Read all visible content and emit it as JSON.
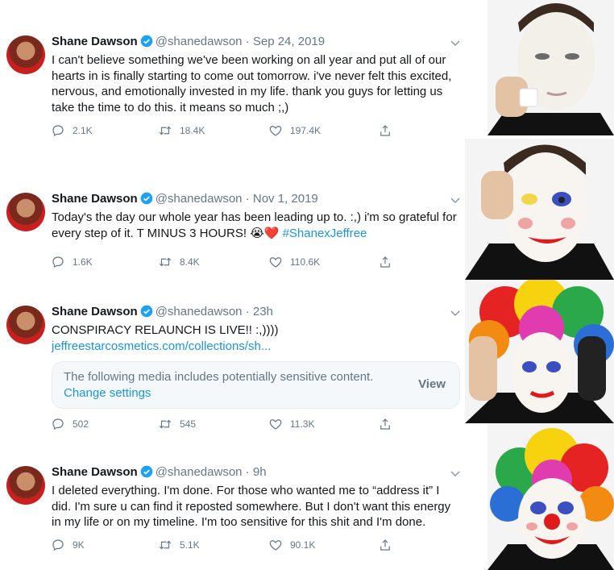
{
  "tweets": [
    {
      "name": "Shane Dawson",
      "handle": "@shanedawson",
      "date": "Sep 24, 2019",
      "text": "I can't believe something we've been working on all year and put all of our hearts in is finally starting to come out tomorrow. i've never felt this excited, nervous, and emotionally invested in my life. thank you guys for letting us take the time to do this. it means so much ;,)",
      "replies": "2.1K",
      "retweets": "18.4K",
      "likes": "197.4K"
    },
    {
      "name": "Shane Dawson",
      "handle": "@shanedawson",
      "date": "Nov 1, 2019",
      "text": "Today's the day our whole year has been leading up to. :,) i'm so grateful for every step of it. T MINUS 3 HOURS!",
      "emoji": "😭❤️",
      "hashtag": "#ShanexJeffree",
      "replies": "1.6K",
      "retweets": "8.4K",
      "likes": "110.6K"
    },
    {
      "name": "Shane Dawson",
      "handle": "@shanedawson",
      "date": "23h",
      "text": "CONSPIRACY RELAUNCH IS LIVE!! :,))))",
      "link": "jeffreestarcosmetics.com/collections/sh...",
      "sensitive_message": "The following media includes potentially sensitive content.",
      "sensitive_change": "Change settings",
      "sensitive_view": "View",
      "replies": "502",
      "retweets": "545",
      "likes": "11.3K"
    },
    {
      "name": "Shane Dawson",
      "handle": "@shanedawson",
      "date": "9h",
      "text": "I deleted everything. I'm done. For those who wanted me to “address it” I did. I'm sure u can find it reposted somewhere. But I don't want this energy in my life or on my timeline. I'm too sensitive for this shit and I'm done.",
      "replies": "9K",
      "retweets": "5.1K",
      "likes": "90.1K"
    }
  ],
  "colors": {
    "accent": "#1b95e0",
    "secondary": "#657786"
  },
  "icons": [
    "verified-icon",
    "chevron-down-icon",
    "reply-icon",
    "retweet-icon",
    "like-icon",
    "share-icon"
  ]
}
